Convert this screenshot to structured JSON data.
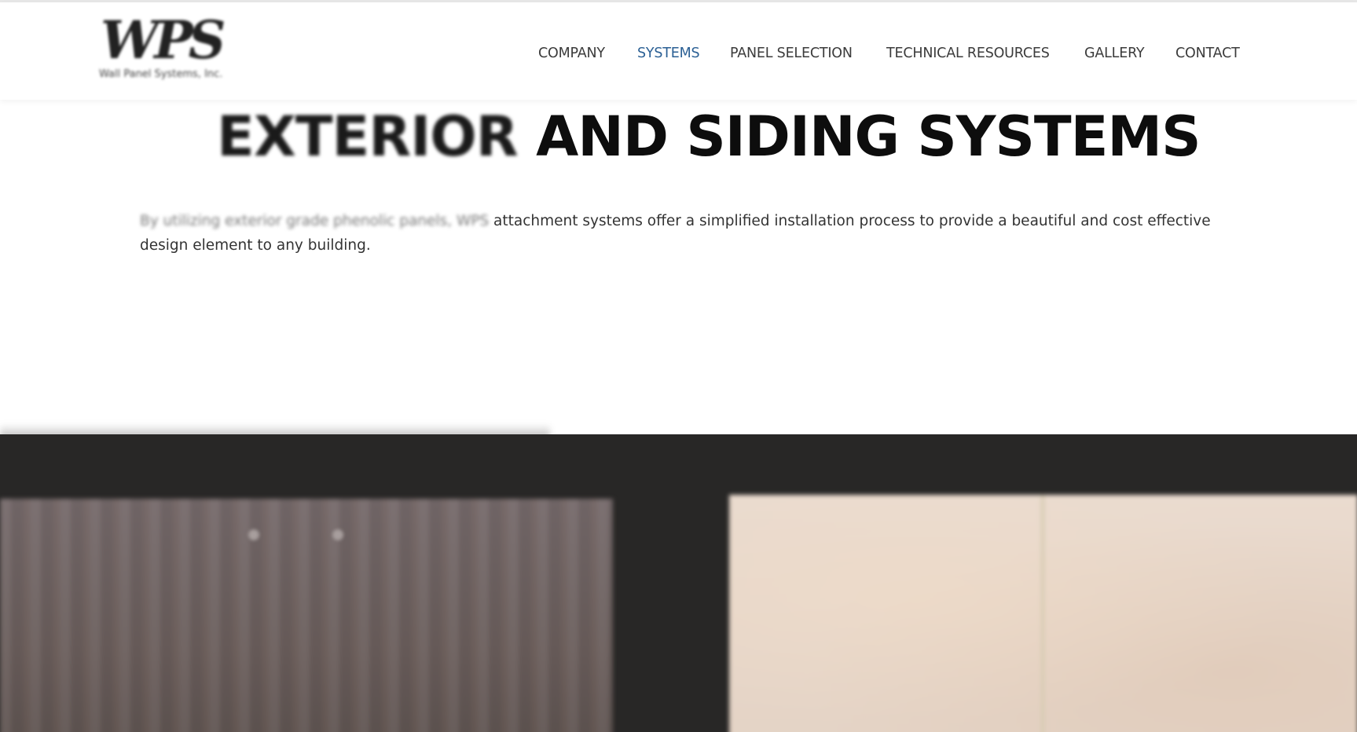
{
  "header": {
    "logo_text": "WPS",
    "logo_subtext": "Wall Panel Systems, Inc."
  },
  "nav": {
    "items": [
      {
        "label": "COMPANY",
        "active": false
      },
      {
        "label": "SYSTEMS",
        "active": true
      },
      {
        "label": "PANEL SELECTION",
        "active": false
      },
      {
        "label": "TECHNICAL RESOURCES",
        "active": false
      },
      {
        "label": "GALLERY",
        "active": false
      },
      {
        "label": "CONTACT",
        "active": false
      }
    ],
    "active_color": "#2a5f94",
    "default_color": "#3b3b3b"
  },
  "hero": {
    "title_part1": "EXTERIOR",
    "title_part2": "AND SIDING SYSTEMS",
    "description_part1": "By utilizing exterior grade phenolic panels, WPS",
    "description_part2": "attachment systems offer a simplified installation process to provide a beautiful and cost effective design element to any building."
  },
  "colors": {
    "band_background": "#282726",
    "dark_panel": "#6d6160",
    "light_panel": "#e7d8cb"
  }
}
